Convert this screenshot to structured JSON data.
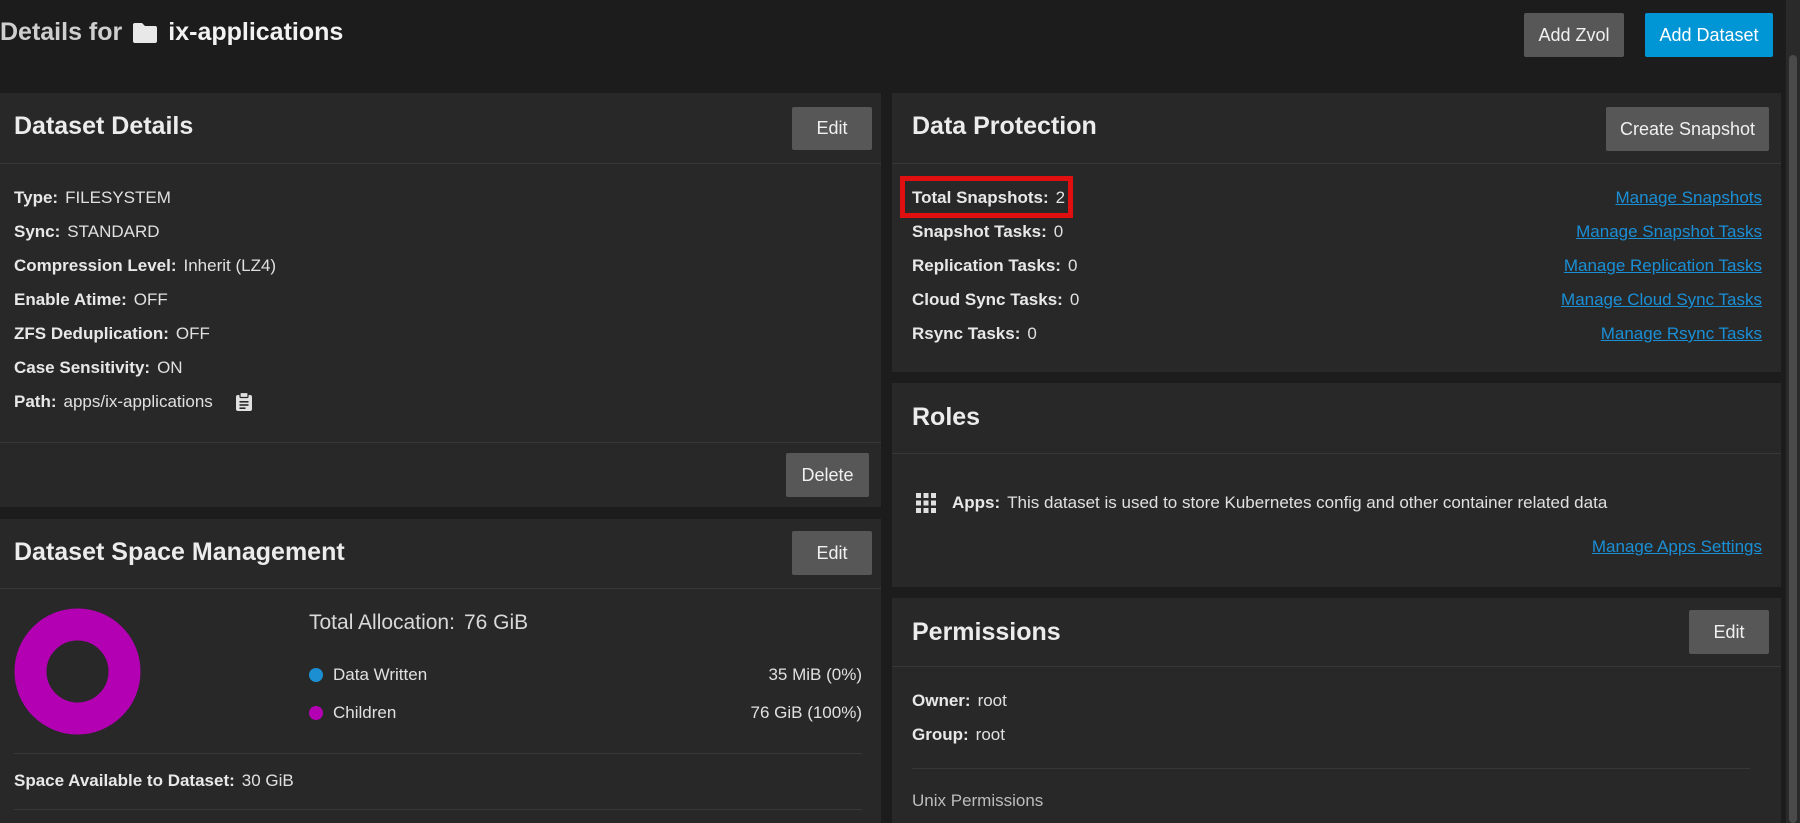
{
  "header": {
    "title_prefix": "Details for",
    "dataset_name": "ix-applications",
    "add_zvol_label": "Add Zvol",
    "add_dataset_label": "Add Dataset"
  },
  "dataset_details": {
    "title": "Dataset Details",
    "edit_label": "Edit",
    "delete_label": "Delete",
    "fields": [
      {
        "label": "Type:",
        "value": "FILESYSTEM"
      },
      {
        "label": "Sync:",
        "value": "STANDARD"
      },
      {
        "label": "Compression Level:",
        "value": "Inherit (LZ4)"
      },
      {
        "label": "Enable Atime:",
        "value": "OFF"
      },
      {
        "label": "ZFS Deduplication:",
        "value": "OFF"
      },
      {
        "label": "Case Sensitivity:",
        "value": "ON"
      },
      {
        "label": "Path:",
        "value": "apps/ix-applications"
      }
    ]
  },
  "space_management": {
    "title": "Dataset Space Management",
    "edit_label": "Edit",
    "total_allocation_label": "Total Allocation:",
    "total_allocation_value": "76 GiB",
    "legend": [
      {
        "label": "Data Written",
        "value": "35 MiB (0%)",
        "color": "#1b8fd2"
      },
      {
        "label": "Children",
        "value": "76 GiB (100%)",
        "color": "#b300b3"
      }
    ],
    "donut_color": "#b300b3",
    "space_available_label": "Space Available to Dataset:",
    "space_available_value": "30 GiB"
  },
  "data_protection": {
    "title": "Data Protection",
    "create_snapshot_label": "Create Snapshot",
    "rows": [
      {
        "label": "Total Snapshots:",
        "value": "2",
        "link": "Manage Snapshots"
      },
      {
        "label": "Snapshot Tasks:",
        "value": "0",
        "link": "Manage Snapshot Tasks"
      },
      {
        "label": "Replication Tasks:",
        "value": "0",
        "link": "Manage Replication Tasks"
      },
      {
        "label": "Cloud Sync Tasks:",
        "value": "0",
        "link": "Manage Cloud Sync Tasks"
      },
      {
        "label": "Rsync Tasks:",
        "value": "0",
        "link": "Manage Rsync Tasks"
      }
    ]
  },
  "roles": {
    "title": "Roles",
    "apps_label": "Apps:",
    "apps_text": "This dataset is used to store Kubernetes config and other container related data",
    "manage_link": "Manage Apps Settings"
  },
  "permissions": {
    "title": "Permissions",
    "edit_label": "Edit",
    "owner_label": "Owner:",
    "owner_value": "root",
    "group_label": "Group:",
    "group_value": "root",
    "unix_label": "Unix Permissions"
  }
}
